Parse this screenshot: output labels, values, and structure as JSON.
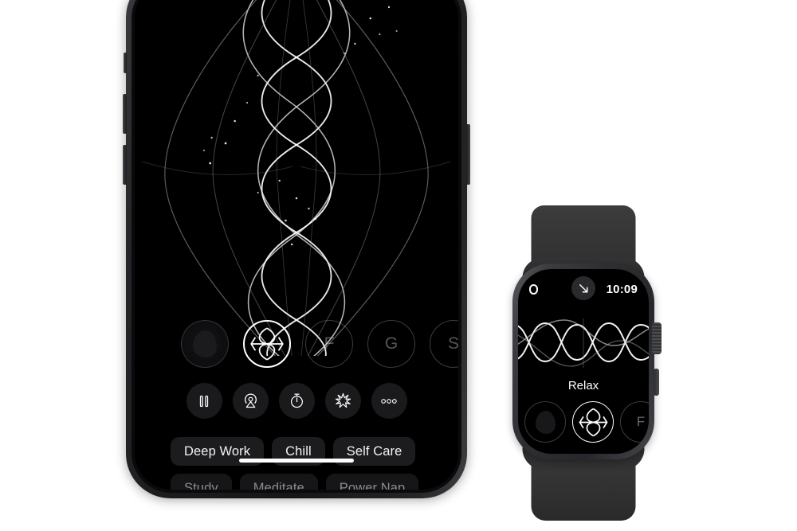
{
  "scene": {
    "background_color": "#ffffff",
    "description": "Endel app shown on an iPhone and an Apple Watch"
  },
  "phone": {
    "frame_color": "#2a2c2e",
    "screen_bg": "#000000",
    "buttons": {
      "silent_switch": "silent-switch",
      "volume_up": "volume-up-button",
      "volume_down": "volume-down-button",
      "power": "power-button"
    },
    "visualization": {
      "name": "generative-soundscape-visualization",
      "stroke_color": "#ffffff",
      "style": "mirrored vertical sine waves with particles"
    },
    "genre_selector": [
      {
        "id": "orb",
        "label": "",
        "icon": "orb-blob-icon",
        "active": false
      },
      {
        "id": "endel",
        "label": "",
        "icon": "endel-logo-icon",
        "active": true
      },
      {
        "id": "focus",
        "label": "F",
        "icon": "",
        "active": false
      },
      {
        "id": "guided",
        "label": "G",
        "icon": "",
        "active": false
      },
      {
        "id": "sleep",
        "label": "S",
        "icon": "",
        "active": false
      }
    ],
    "controls": [
      {
        "id": "pause",
        "name": "pause-button",
        "icon": "pause-icon"
      },
      {
        "id": "airplay",
        "name": "airplay-button",
        "icon": "airplay-icon"
      },
      {
        "id": "timer",
        "name": "timer-button",
        "icon": "stopwatch-icon"
      },
      {
        "id": "intensity",
        "name": "intensity-button",
        "icon": "sparkle-burst-icon"
      },
      {
        "id": "more",
        "name": "more-button",
        "icon": "ellipsis-icon"
      }
    ],
    "mood_chips": [
      {
        "label": "Deep Work",
        "dim": false
      },
      {
        "label": "Chill",
        "dim": false
      },
      {
        "label": "Self Care",
        "dim": false
      },
      {
        "label": "Study",
        "dim": true
      },
      {
        "label": "Meditate",
        "dim": true
      },
      {
        "label": "Power Nap",
        "dim": true
      }
    ],
    "home_indicator": "home-indicator"
  },
  "watch": {
    "case_color": "#3a3c3f",
    "band_color": "#353535",
    "screen_bg": "#000000",
    "status": {
      "app_indicator": "app-status-icon",
      "back_arrow": "back-arrow-icon",
      "time": "10:09"
    },
    "visualization": {
      "name": "soundscape-wave-visualization",
      "stroke_color": "#ffffff",
      "style": "horizontal interleaved sine waves"
    },
    "now_playing_label": "Relax",
    "genre_selector": [
      {
        "id": "orb",
        "label": "",
        "icon": "orb-blob-icon",
        "active": false
      },
      {
        "id": "endel",
        "label": "",
        "icon": "endel-logo-icon",
        "active": true
      },
      {
        "id": "focus",
        "label": "F",
        "icon": "",
        "active": false
      },
      {
        "id": "guided",
        "label": "",
        "icon": "",
        "active": false
      }
    ],
    "crown": "digital-crown",
    "side_button": "side-button"
  }
}
